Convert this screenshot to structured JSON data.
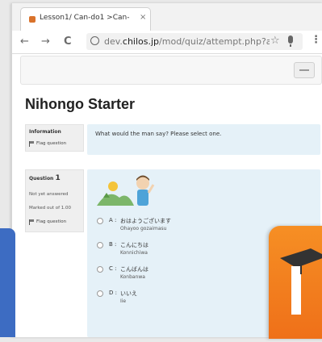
{
  "browser": {
    "tab_title": "Lesson1/ Can-do1 >Can-",
    "tab_close": "×",
    "url_prefix": "dev.",
    "url_domain": "chilos.jp",
    "url_path": "/mod/quiz/attempt.php?at",
    "back_glyph": "←",
    "forward_glyph": "→",
    "reload_glyph": "C",
    "star_glyph": "☆",
    "menu_glyph": "⋮"
  },
  "page": {
    "title": "Nihongo Starter"
  },
  "info_block": {
    "title": "Information",
    "flag_label": "Flag question",
    "prompt": "What would the man say?  Please select one."
  },
  "question": {
    "label": "Question",
    "number": "1",
    "status": "Not yet answered",
    "marks": "Marked out of 1.00",
    "flag_label": "Flag question",
    "answers": [
      {
        "letter": "A :",
        "japanese": "おはようございます",
        "romaji": "Ohayoo gozaimasu"
      },
      {
        "letter": "B :",
        "japanese": "こんにちは",
        "romaji": "Konnichiwa"
      },
      {
        "letter": "C :",
        "japanese": "こんばんは",
        "romaji": "Konbanwa"
      },
      {
        "letter": "D :",
        "japanese": "いいえ",
        "romaji": "Iie"
      }
    ]
  },
  "colors": {
    "accent_blue": "#3d6cc2",
    "moodle_orange": "#f68f24",
    "question_bg": "#e5f1f8"
  },
  "icons": [
    "favicon-icon",
    "back-icon",
    "forward-icon",
    "reload-icon",
    "info-icon",
    "star-icon",
    "mic-icon",
    "menu-icon",
    "flag-icon",
    "moodle-logo"
  ]
}
